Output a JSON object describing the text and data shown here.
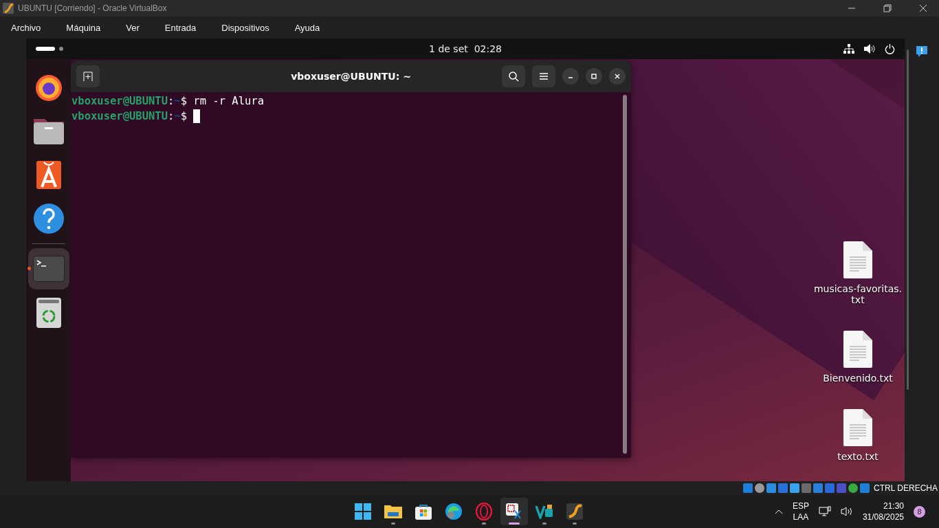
{
  "window": {
    "title": "UBUNTU [Corriendo] - Oracle VirtualBox"
  },
  "menu": [
    "Archivo",
    "Máquina",
    "Ver",
    "Entrada",
    "Dispositivos",
    "Ayuda"
  ],
  "ubuntu_top_bar": {
    "workspaces": [
      {
        "selected": true
      },
      {
        "selected": false
      }
    ],
    "clock": "1 de set  02:28"
  },
  "dock": [
    {
      "kind": "firefox",
      "running": false
    },
    {
      "kind": "files",
      "running": false
    },
    {
      "kind": "appcenter",
      "running": false
    },
    {
      "kind": "help",
      "running": false
    },
    {
      "kind": "terminal",
      "running": true
    },
    {
      "kind": "trash",
      "running": false
    }
  ],
  "terminal": {
    "title": "vboxuser@UBUNTU: ~",
    "lines": [
      {
        "user_host": "vboxuser@UBUNTU",
        "separator": ":",
        "path": "~",
        "symbol": "$",
        "command": "rm -r Alura",
        "cursor": false
      },
      {
        "user_host": "vboxuser@UBUNTU",
        "separator": ":",
        "path": "~",
        "symbol": "$",
        "cursor": true
      }
    ]
  },
  "desktop_files": [
    "musicas-favoritas.\ntxt",
    "Bienvenido.txt",
    "texto.txt"
  ],
  "status_bar": {
    "host_key": "CTRL DERECHA"
  },
  "taskbar": [
    {
      "kind": "start",
      "running": false,
      "selected": false
    },
    {
      "kind": "explorer",
      "running": true,
      "selected": false
    },
    {
      "kind": "store",
      "running": false,
      "selected": false
    },
    {
      "kind": "edge",
      "running": false,
      "selected": false
    },
    {
      "kind": "opera",
      "running": true,
      "selected": false
    },
    {
      "kind": "snipping",
      "running": true,
      "selected": true
    },
    {
      "kind": "vs",
      "running": true,
      "selected": false
    },
    {
      "kind": "virtualbox",
      "running": true,
      "selected": false
    }
  ],
  "tray": {
    "language": "ESP",
    "layout": "LAA",
    "time": "21:30",
    "date": "31/08/2025",
    "notifications": "8"
  }
}
